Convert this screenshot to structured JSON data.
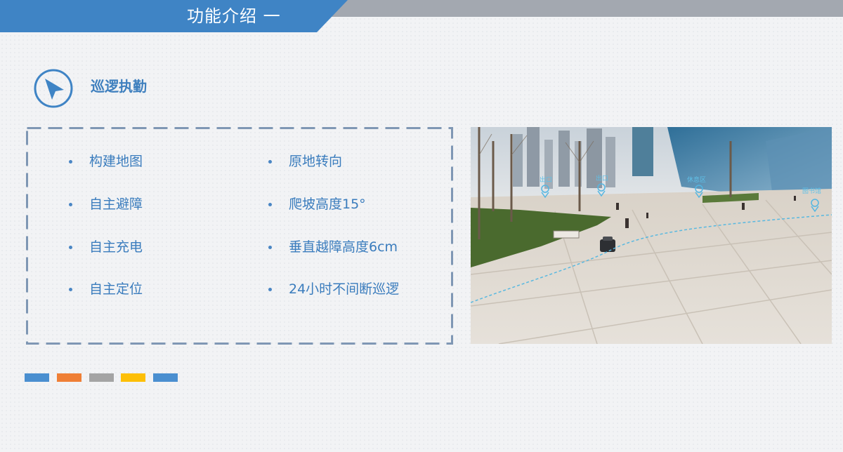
{
  "header": {
    "title": "功能介绍 一"
  },
  "section": {
    "title": "巡逻执勤",
    "icon": "navigation-arrow-icon"
  },
  "features": {
    "left": [
      "构建地图",
      "自主避障",
      "自主充电",
      "自主定位"
    ],
    "right": [
      "原地转向",
      "爬坡高度15°",
      "垂直越障高度6cm",
      "24小时不间断巡逻"
    ]
  },
  "photo": {
    "map_labels": [
      "出口",
      "出口",
      "休息区",
      "图书馆"
    ]
  },
  "colors": {
    "accent": "#3f84c5",
    "text": "#3a7cbd",
    "bars": [
      "#4a8fd0",
      "#ef7f36",
      "#a4a4a4",
      "#fdbf07",
      "#4a8fd0"
    ]
  }
}
